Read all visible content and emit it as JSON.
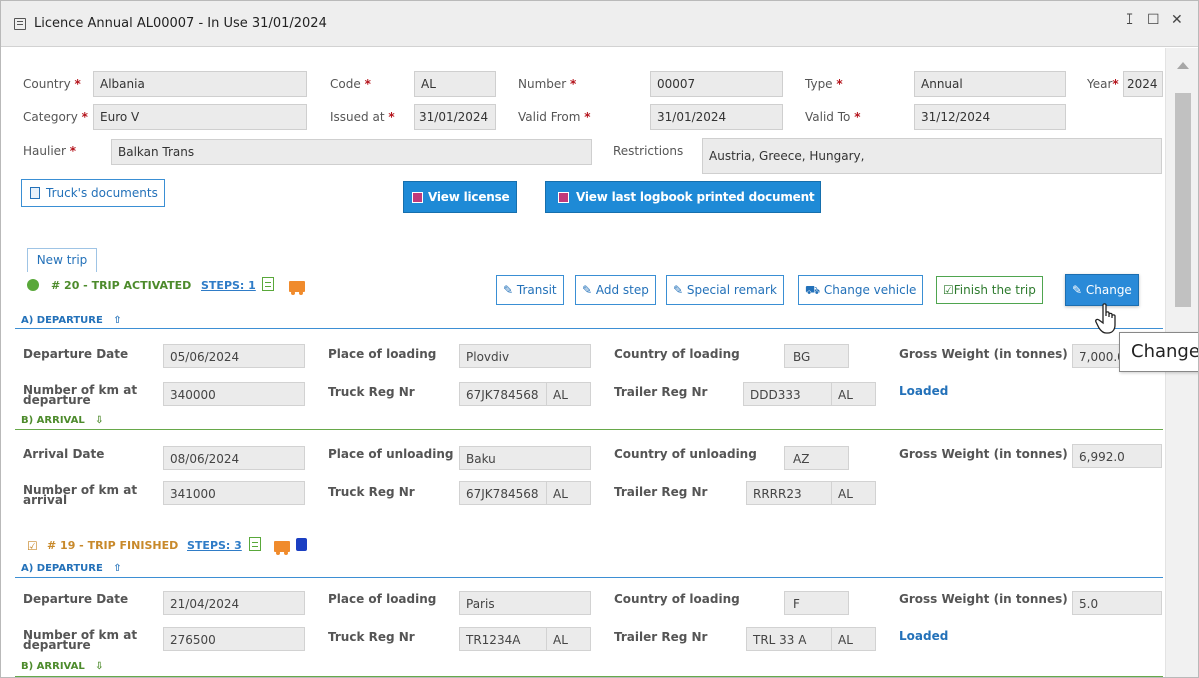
{
  "window": {
    "title": "Licence Annual AL00007 - In Use 31/01/2024",
    "controls": [
      "ꕯ",
      "☐",
      "✕"
    ]
  },
  "licence": {
    "country_label": "Country",
    "country_value": "Albania",
    "code_label": "Code",
    "code_value": "AL",
    "number_label": "Number",
    "number_value": "00007",
    "type_label": "Type",
    "type_value": "Annual",
    "year_label": "Year",
    "year_value": "2024",
    "category_label": "Category",
    "category_value": "Euro V",
    "issued_label": "Issued at",
    "issued_value": "31/01/2024",
    "valid_from_label": "Valid From",
    "valid_from_value": "31/01/2024",
    "valid_to_label": "Valid To",
    "valid_to_value": "31/12/2024",
    "haulier_label": "Haulier",
    "haulier_value": "Balkan Trans",
    "restrictions_label": "Restrictions",
    "restrictions_value": "Austria,  Greece,  Hungary,",
    "required_mark": "*"
  },
  "buttons": {
    "trucks_documents": "Truck's documents",
    "view_license": "View license",
    "view_last_logbook": "View last logbook printed document",
    "new_trip": "New trip",
    "transit": "Transit",
    "add_step": "Add step",
    "special_remark": "Special remark",
    "change_vehicle": "Change vehicle",
    "finish_trip": "Finish the trip",
    "change": "Change",
    "tooltip": "Change"
  },
  "trips": [
    {
      "header": "# 20 - TRIP ACTIVATED",
      "steps_link": "STEPS: 1",
      "header_color": "#4d8b2c",
      "departure_title": "A) DEPARTURE",
      "departure": {
        "date_label": "Departure Date",
        "date_value": "05/06/2024",
        "place_label": "Place of loading",
        "place_value": "Plovdiv",
        "country_label": "Country of loading",
        "country_value": "BG",
        "weight_label": "Gross Weight (in tonnes)",
        "weight_value": "7,000.0",
        "km_label": "Number of km at departure",
        "km_value": "340000",
        "truck_label": "Truck Reg Nr",
        "truck_value": "67JK784568",
        "truck_country": "AL",
        "trailer_label": "Trailer Reg Nr",
        "trailer_value": "DDD333",
        "trailer_country": "AL",
        "status": "Loaded"
      },
      "arrival_title": "B) ARRIVAL",
      "arrival": {
        "date_label": "Arrival Date",
        "date_value": "08/06/2024",
        "place_label": "Place of unloading",
        "place_value": "Baku",
        "country_label": "Country of unloading",
        "country_value": "AZ",
        "weight_label": "Gross Weight (in tonnes)",
        "weight_value": "6,992.0",
        "km_label": "Number of km at arrival",
        "km_value": "341000",
        "truck_label": "Truck Reg Nr",
        "truck_value": "67JK784568",
        "truck_country": "AL",
        "trailer_label": "Trailer Reg Nr",
        "trailer_value": "RRRR23",
        "trailer_country": "AL"
      }
    },
    {
      "header": "# 19 - TRIP FINISHED",
      "steps_link": "STEPS: 3",
      "header_color": "#c8892a",
      "departure_title": "A) DEPARTURE",
      "departure": {
        "date_label": "Departure Date",
        "date_value": "21/04/2024",
        "place_label": "Place of loading",
        "place_value": "Paris",
        "country_label": "Country of loading",
        "country_value": "F",
        "weight_label": "Gross Weight (in tonnes)",
        "weight_value": "5.0",
        "km_label": "Number of km at departure",
        "km_value": "276500",
        "truck_label": "Truck Reg Nr",
        "truck_value": "TR1234A",
        "truck_country": "AL",
        "trailer_label": "Trailer Reg Nr",
        "trailer_value": "TRL 33 A",
        "trailer_country": "AL",
        "status": "Loaded"
      },
      "arrival_title": "B) ARRIVAL"
    }
  ]
}
